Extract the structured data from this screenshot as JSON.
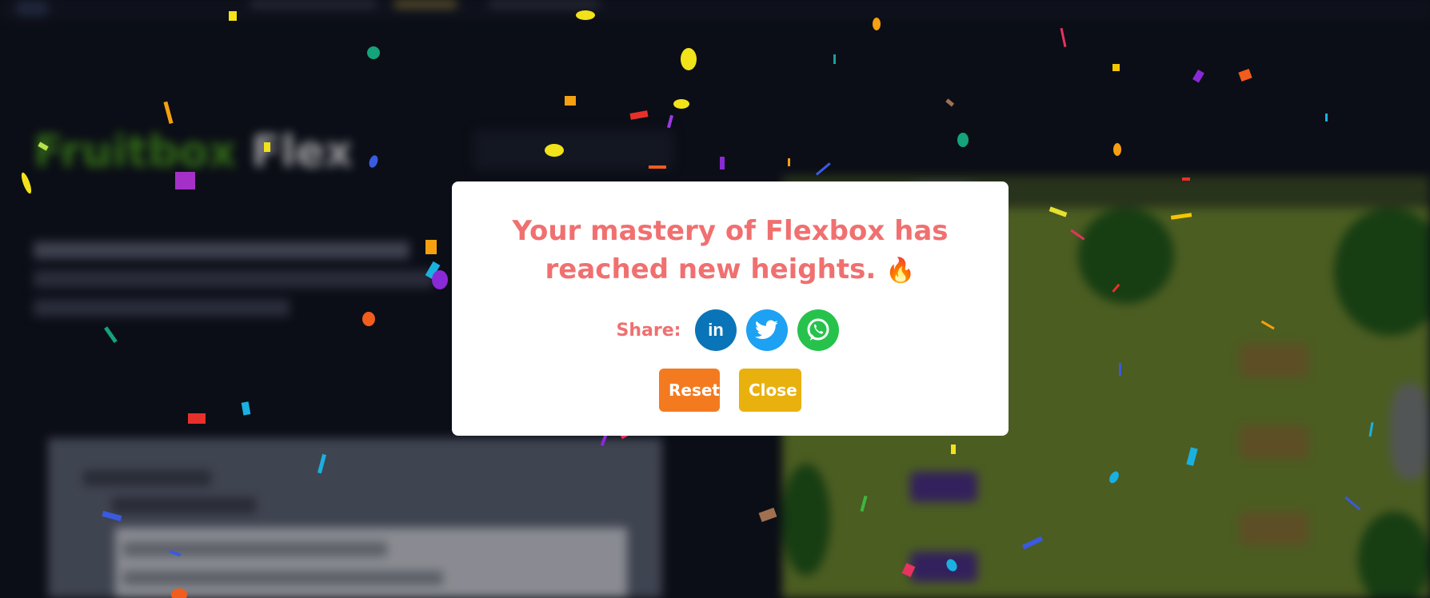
{
  "app": {
    "brand_part1": "Fruitbox",
    "brand_part2": "Flex"
  },
  "modal": {
    "message": "Your mastery of Flexbox has reached new heights.",
    "emoji": "🔥",
    "share_label": "Share:",
    "share_buttons": [
      {
        "name": "linkedin-icon",
        "glyph": "in",
        "color": "#0a74b8"
      },
      {
        "name": "twitter-icon",
        "glyph": "twitter-bird",
        "color": "#1da1f2"
      },
      {
        "name": "whatsapp-icon",
        "glyph": "whatsapp-phone",
        "color": "#27c24c"
      }
    ],
    "reset_label": "Reset",
    "close_label": "Close",
    "colors": {
      "accent_text": "#f07070",
      "reset": "#f47a20",
      "close": "#e9b10d"
    }
  }
}
